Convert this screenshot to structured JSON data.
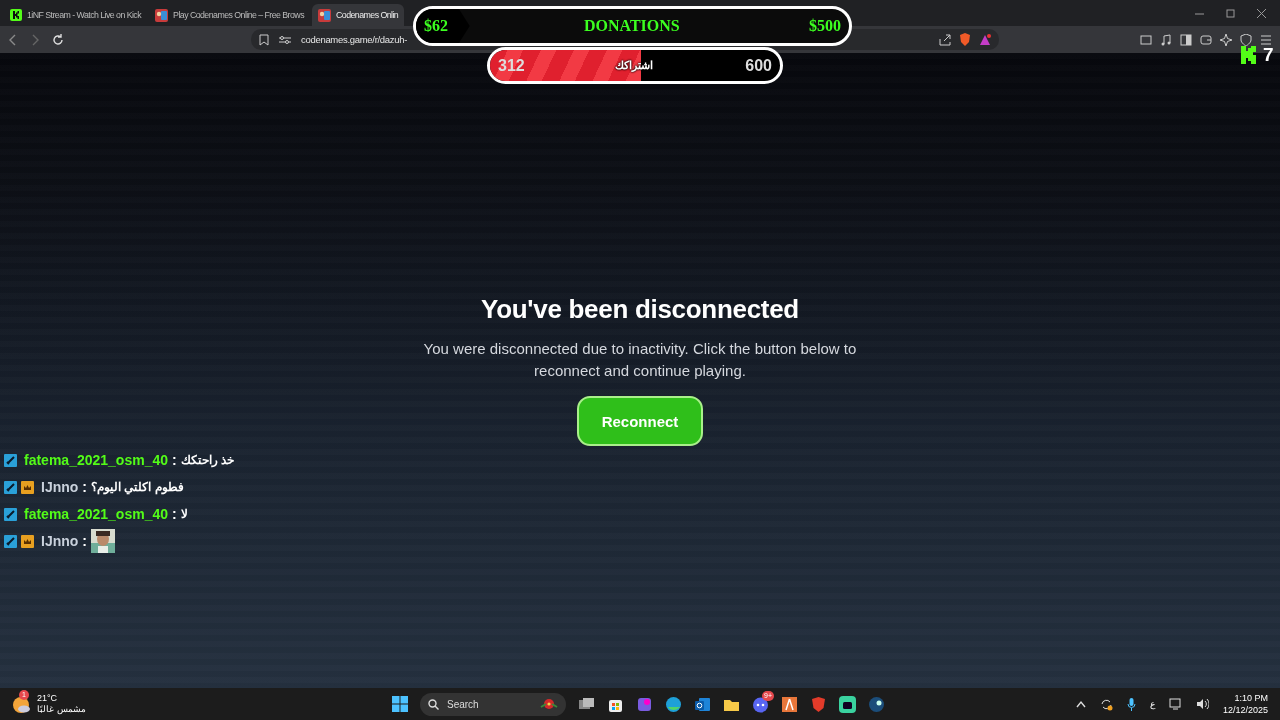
{
  "browser": {
    "tabs": [
      {
        "title": "1iNF Stream - Watch Live on Kick",
        "kind": "kick",
        "selected": false
      },
      {
        "title": "Play Codenames Online – Free Brows",
        "kind": "codenames",
        "selected": false
      },
      {
        "title": "Codenames Onlin",
        "kind": "codenames",
        "selected": true
      }
    ],
    "address": "codenames.game/r/dazuh-"
  },
  "dialog": {
    "title": "You've been disconnected",
    "message": "You were disconnected due to inactivity. Click the button below to reconnect and continue playing.",
    "button": "Reconnect"
  },
  "overlay": {
    "donations": {
      "raised": "$62",
      "label": "DONATIONS",
      "goal": "$500",
      "level": 0.124
    },
    "subscribers": {
      "count": "312",
      "label": "اشتراكك",
      "goal": "600",
      "level": 0.52
    },
    "logo_number": "7",
    "chat": [
      {
        "badges": [
          {
            "kind": "sword"
          }
        ],
        "user": "fatema_2021_osm_40",
        "color": "#53fc18",
        "separator": ":",
        "text": "خذ راحتكك"
      },
      {
        "badges": [
          {
            "kind": "sword"
          },
          {
            "kind": "crown"
          }
        ],
        "user": "IJnno",
        "color": "#c9d1dc",
        "separator": ":",
        "text": "فطوم اكلتي اليوم؟"
      },
      {
        "badges": [
          {
            "kind": "sword"
          }
        ],
        "user": "fatema_2021_osm_40",
        "color": "#53fc18",
        "separator": ":",
        "text": "لا"
      },
      {
        "badges": [
          {
            "kind": "sword"
          },
          {
            "kind": "crown"
          }
        ],
        "user": "IJnno",
        "color": "#c9d1dc",
        "separator": ":",
        "emote": true
      }
    ]
  },
  "taskbar": {
    "weather": {
      "badge": "1",
      "temperature": "21°C",
      "condition": "مشمس غالبًا"
    },
    "search": "Search",
    "discord_badge": "9+",
    "language": "ع",
    "time": "1:10 PM",
    "date": "12/12/2025"
  }
}
